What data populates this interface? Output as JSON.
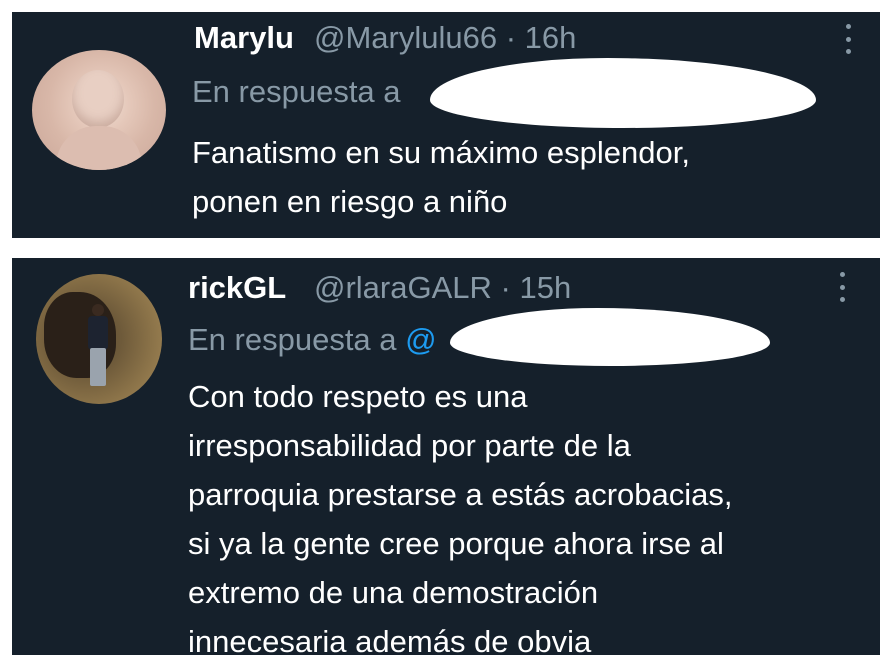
{
  "tweets": [
    {
      "display_name": "Marylu",
      "handle": "@Marylulu66",
      "separator": "·",
      "time": "16h",
      "reply_prefix": "En respuesta a",
      "reply_mention": "",
      "text_lines": [
        "Fanatismo en su máximo esplendor,",
        "ponen en riesgo a niño"
      ],
      "avatar_icon": "user-avatar-photo",
      "more_icon": "vertical-ellipsis-icon"
    },
    {
      "display_name": "rickGL",
      "handle": "@rlaraGALR",
      "separator": "·",
      "time": "15h",
      "reply_prefix": "En respuesta a",
      "reply_mention": "@",
      "text_lines": [
        "Con todo respeto es una",
        "irresponsabilidad por parte de la",
        "parroquia prestarse a estás acrobacias,",
        "si ya la gente cree porque ahora irse al",
        "extremo de una demostración",
        "innecesaria además de obvia"
      ],
      "avatar_icon": "user-avatar-photo",
      "more_icon": "vertical-ellipsis-icon"
    }
  ],
  "colors": {
    "card_background": "#15202b",
    "primary_text": "#ffffff",
    "secondary_text": "#8899a6",
    "accent": "#1d9bf0",
    "page_background": "#ffffff",
    "redaction": "#ffffff"
  }
}
